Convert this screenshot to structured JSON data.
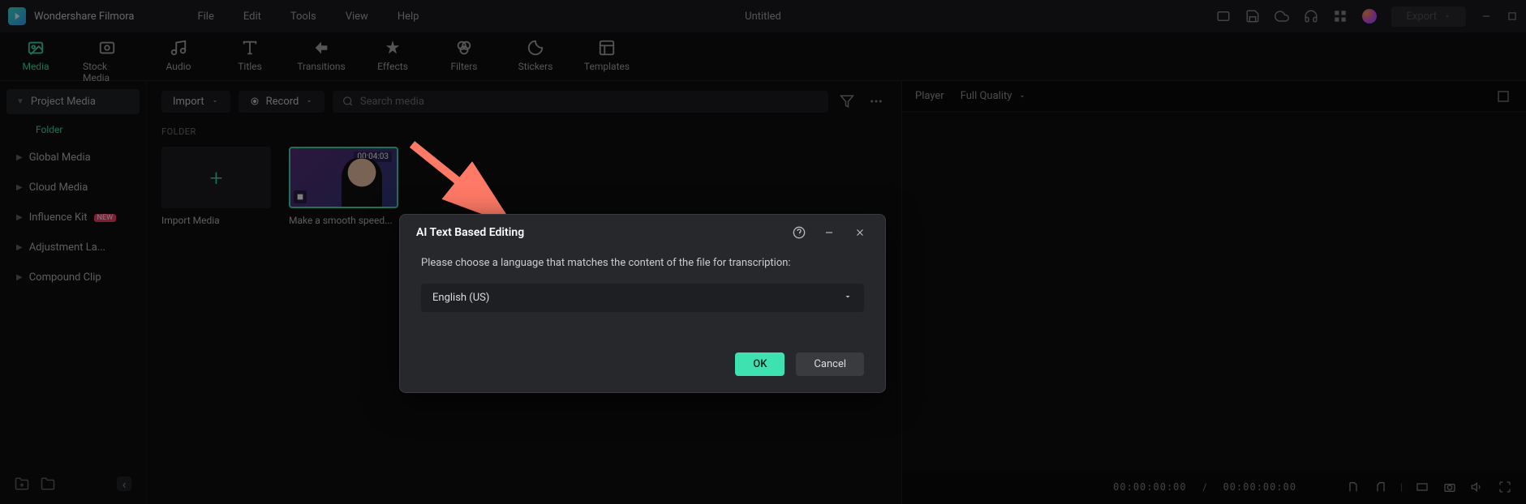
{
  "app": {
    "name": "Wondershare Filmora",
    "doc_title": "Untitled",
    "export_label": "Export"
  },
  "menu": {
    "file": "File",
    "edit": "Edit",
    "tools": "Tools",
    "view": "View",
    "help": "Help"
  },
  "tabs": {
    "media": "Media",
    "stock": "Stock Media",
    "audio": "Audio",
    "titles": "Titles",
    "transitions": "Transitions",
    "effects": "Effects",
    "filters": "Filters",
    "stickers": "Stickers",
    "templates": "Templates"
  },
  "sidebar": {
    "project": "Project Media",
    "folder": "Folder",
    "global": "Global Media",
    "cloud": "Cloud Media",
    "influence": "Influence Kit",
    "influence_badge": "NEW",
    "adjustment": "Adjustment La...",
    "compound": "Compound Clip"
  },
  "content": {
    "import_btn": "Import",
    "record_btn": "Record",
    "search_placeholder": "Search media",
    "section": "FOLDER",
    "import_card": "Import Media",
    "clip_name": "Make a smooth speed...",
    "clip_duration": "00:04:03"
  },
  "preview": {
    "player": "Player",
    "quality": "Full Quality",
    "tc_cur": "00:00:00:00",
    "tc_sep": "/",
    "tc_total": "00:00:00:00"
  },
  "dialog": {
    "title": "AI Text Based Editing",
    "msg": "Please choose a language that matches the content of the file for transcription:",
    "lang": "English (US)",
    "ok": "OK",
    "cancel": "Cancel"
  }
}
